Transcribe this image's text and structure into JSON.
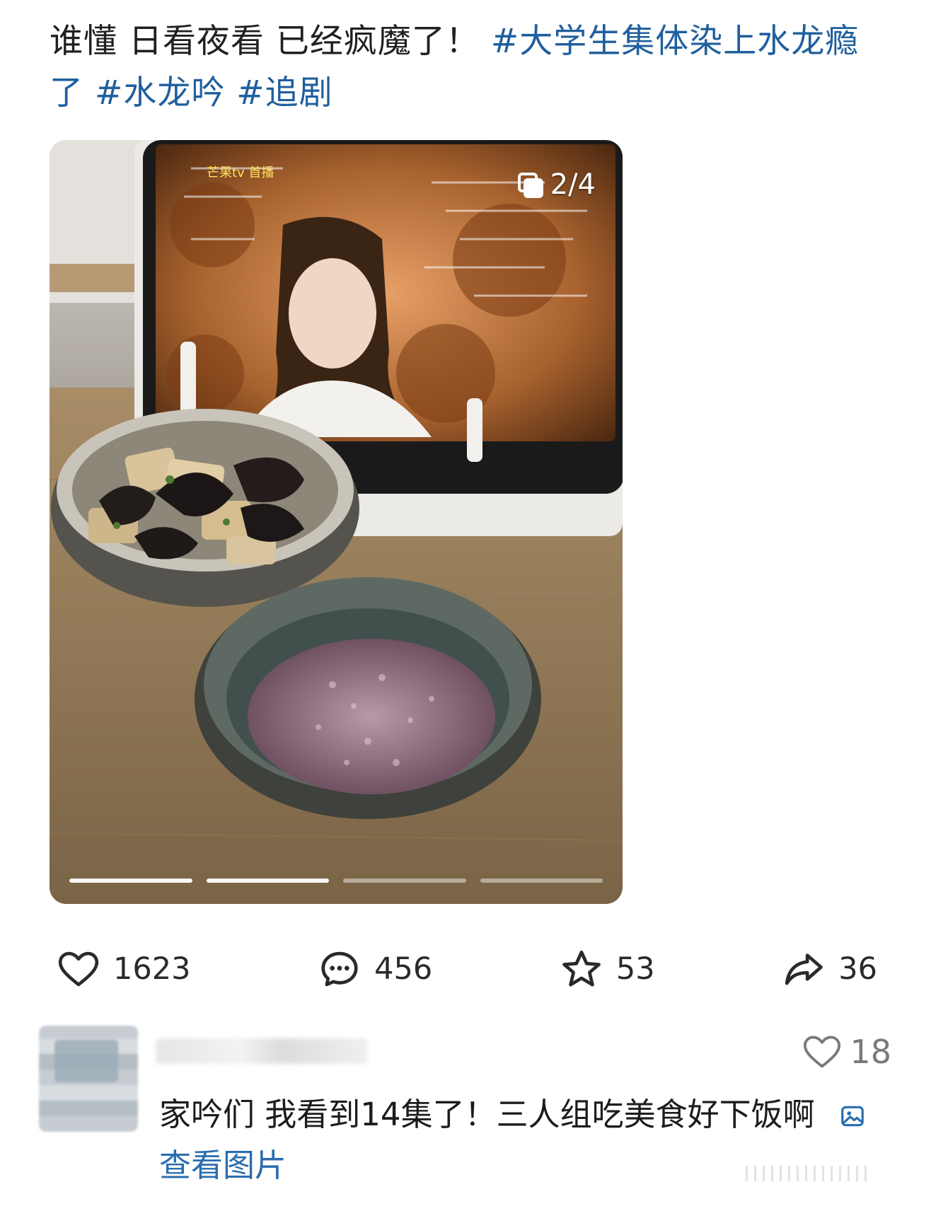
{
  "post": {
    "text": "谁懂 日看夜看 已经疯魔了！",
    "tags": [
      "#大学生集体染上水龙瘾了",
      "#水龙吟",
      "#追剧"
    ]
  },
  "photo": {
    "counter": "2/4",
    "screen_watermark": "芒果tv 首播",
    "page_count": 4,
    "active_page": 2
  },
  "actions": {
    "likes": "1623",
    "comments": "456",
    "favorites": "53",
    "shares": "36"
  },
  "comment": {
    "likes": "18",
    "text": "家吟们 我看到14集了！三人组吃美食好下饭啊",
    "view_image_label": "查看图片"
  },
  "colors": {
    "tag": "#1f5f9e",
    "link": "#2a6db0"
  }
}
